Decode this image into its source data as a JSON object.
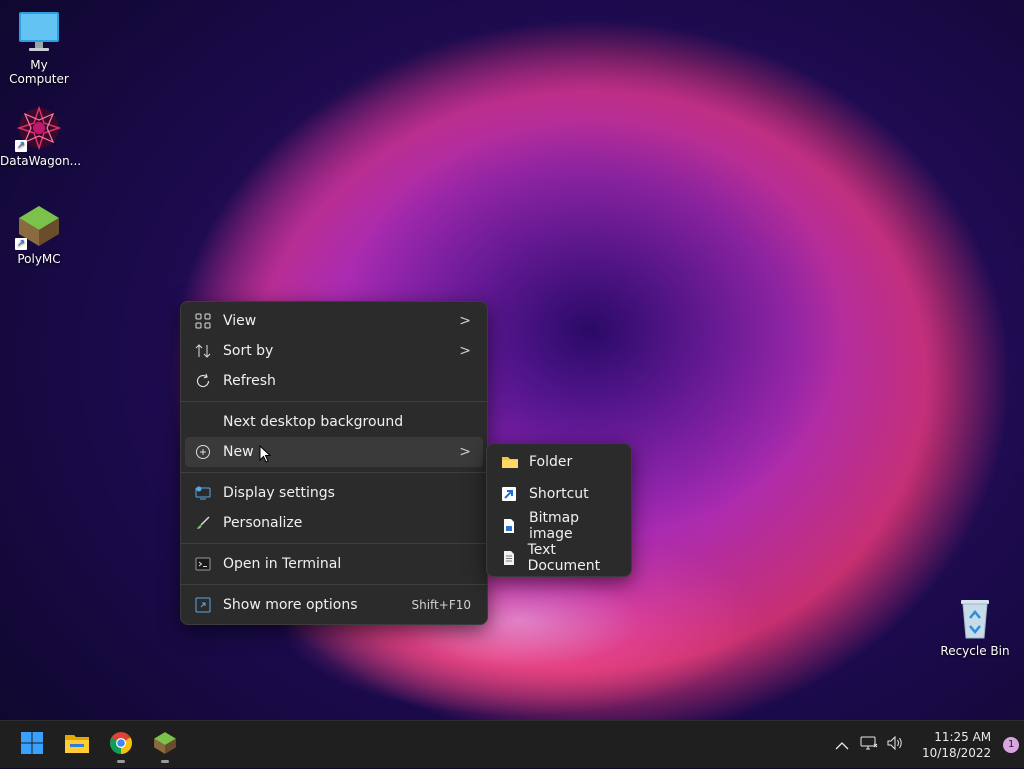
{
  "desktop": {
    "icons": [
      {
        "label": "My Computer"
      },
      {
        "label": "DataWagon..."
      },
      {
        "label": "PolyMC"
      },
      {
        "label": "Recycle Bin"
      }
    ]
  },
  "context_menu": {
    "items": [
      {
        "label": "View",
        "icon": "grid-icon",
        "submenu": true
      },
      {
        "label": "Sort by",
        "icon": "sort-icon",
        "submenu": true
      },
      {
        "label": "Refresh",
        "icon": "refresh-icon"
      },
      {
        "label": "Next desktop background"
      },
      {
        "label": "New",
        "icon": "plus-circle-icon",
        "submenu": true
      },
      {
        "label": "Display settings",
        "icon": "display-icon"
      },
      {
        "label": "Personalize",
        "icon": "brush-icon"
      },
      {
        "label": "Open in Terminal",
        "icon": "terminal-icon"
      },
      {
        "label": "Show more options",
        "icon": "expand-icon",
        "accelerator": "Shift+F10"
      }
    ],
    "chevron": ">"
  },
  "new_submenu": {
    "items": [
      {
        "label": "Folder",
        "icon": "folder-icon"
      },
      {
        "label": "Shortcut",
        "icon": "shortcut-icon"
      },
      {
        "label": "Bitmap image",
        "icon": "bitmap-icon"
      },
      {
        "label": "Text Document",
        "icon": "text-document-icon"
      }
    ]
  },
  "taskbar": {
    "apps": [
      "start-icon",
      "file-explorer-icon",
      "chrome-icon",
      "polymc-icon"
    ],
    "clock": {
      "time": "11:25 AM",
      "date": "10/18/2022"
    },
    "notification_count": "1",
    "tray_chevron": "^"
  },
  "colors": {
    "menu_bg": "#2b2b2b",
    "taskbar_bg": "#1f1f1f",
    "accent": "#0078d4"
  }
}
